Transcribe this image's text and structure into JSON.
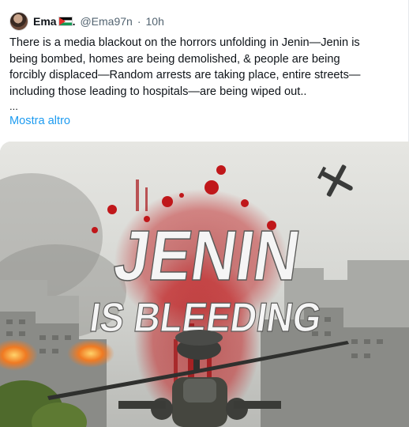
{
  "tweet": {
    "display_name": "Ema",
    "name_suffix": ".",
    "handle": "@Ema97n",
    "separator": "·",
    "time": "10h",
    "text_lines": [
      "There is a media blackout on the horrors unfolding in Jenin—Jenin is",
      "being bombed, homes are being demolished, & people are being",
      "forcibly displaced—Random arrests are taking place, entire streets—",
      "including those leading to hospitals—are being wiped out.."
    ],
    "ellipsis": "...",
    "show_more": "Mostra altro"
  },
  "media": {
    "headline_line1": "JENIN",
    "headline_line2": "IS BLEEDING",
    "flag_colors": [
      "#000000",
      "#ffffff",
      "#149954",
      "#e4312b"
    ],
    "icons": [
      "avatar",
      "palestine-flag-icon",
      "drone-icon",
      "helicopter-icon"
    ]
  }
}
